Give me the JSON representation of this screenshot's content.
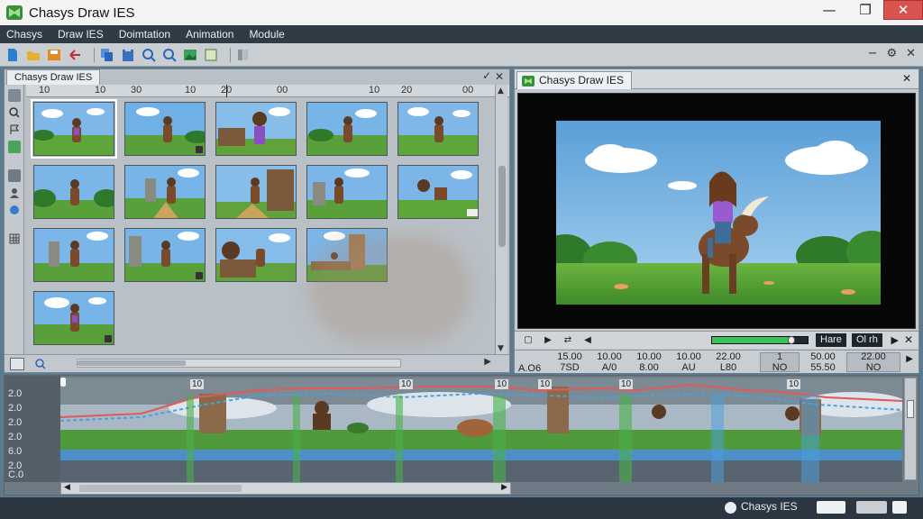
{
  "window": {
    "title": "Chasys Draw IES",
    "minimize_glyph": "—",
    "maximize_glyph": "❐",
    "close_glyph": "✕"
  },
  "menu": [
    "Chasys",
    "Draw IES",
    "Doimtation",
    "Animation",
    "Module"
  ],
  "toolbar": {
    "icons": [
      "new-file-icon",
      "open-folder-icon",
      "save-icon",
      "undo-icon",
      "copy-icon",
      "paste-icon",
      "zoom-in-icon",
      "zoom-out-icon",
      "image-icon",
      "canvas-icon",
      "frames-icon"
    ],
    "right_glyphs": [
      "−",
      "⚙",
      "✕"
    ]
  },
  "left_panel": {
    "tab": "Chasys Draw IES",
    "pin_glyph": "✓",
    "close_glyph": "✕",
    "ruler_labels": [
      "10",
      "10",
      "30",
      "10",
      "20",
      "00",
      "10",
      "20",
      "00"
    ],
    "thumbnails_count": 16,
    "footer_arrow": "▶"
  },
  "right_panel": {
    "tab": "Chasys Draw IES",
    "close_glyph": "✕",
    "progress": 0.83,
    "label_a": "Hare",
    "label_b": "Ol rh",
    "play_glyph": "▶",
    "close2_glyph": "✕",
    "readout": [
      {
        "top": "15.00",
        "bottom": "7SD"
      },
      {
        "top": "10.00",
        "bottom": "A/0"
      },
      {
        "top": "10.00",
        "bottom": "8.00"
      },
      {
        "top": "10.00",
        "bottom": "AU"
      },
      {
        "top": "22.00",
        "bottom": "L80"
      },
      {
        "top": "1",
        "bottom": "NO"
      },
      {
        "top": "50.00",
        "bottom": "55.50"
      },
      {
        "top": "22.00",
        "bottom": "NO"
      }
    ],
    "readout_left": {
      "top": "",
      "bottom": "A.O6"
    }
  },
  "timeline": {
    "labels": [
      "2.0",
      "2.0",
      "2.0",
      "2.0",
      "6.0",
      "2.0",
      "C.0"
    ],
    "ruler_numbers": [
      "10",
      "10",
      "10",
      "10",
      "10",
      "10"
    ],
    "tick_labels_top": "0"
  },
  "status": {
    "app_name": "Chasys IES"
  },
  "colors": {
    "accent_green": "#3cc25b",
    "menu_bg": "#303b45",
    "status_bg": "#2c3640"
  }
}
